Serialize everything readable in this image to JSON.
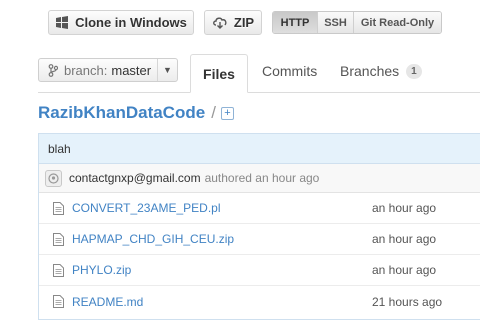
{
  "toolbar": {
    "clone_label": "Clone in Windows",
    "zip_label": "ZIP",
    "protocols": [
      "HTTP",
      "SSH",
      "Git Read-Only"
    ],
    "selected_protocol": "HTTP"
  },
  "branch": {
    "label": "branch:",
    "value": "master"
  },
  "tabs": {
    "files": "Files",
    "commits": "Commits",
    "branches": "Branches",
    "branches_count": "1"
  },
  "repo": {
    "name": "RazibKhanDataCode",
    "separator": "/"
  },
  "commit": {
    "message": "blah",
    "author_email": "contactgnxp@gmail.com",
    "authored_text": "authored an hour ago"
  },
  "files": [
    {
      "name": "CONVERT_23AME_PED.pl",
      "age": "an hour ago",
      "icon": "file-icon"
    },
    {
      "name": "HAPMAP_CHD_GIH_CEU.zip",
      "age": "an hour ago",
      "icon": "file-icon"
    },
    {
      "name": "PHYLO.zip",
      "age": "an hour ago",
      "icon": "file-icon"
    },
    {
      "name": "README.md",
      "age": "21 hours ago",
      "icon": "file-icon"
    }
  ],
  "colors": {
    "link": "#4183c4",
    "commit_bar": "#e5f2fb"
  }
}
